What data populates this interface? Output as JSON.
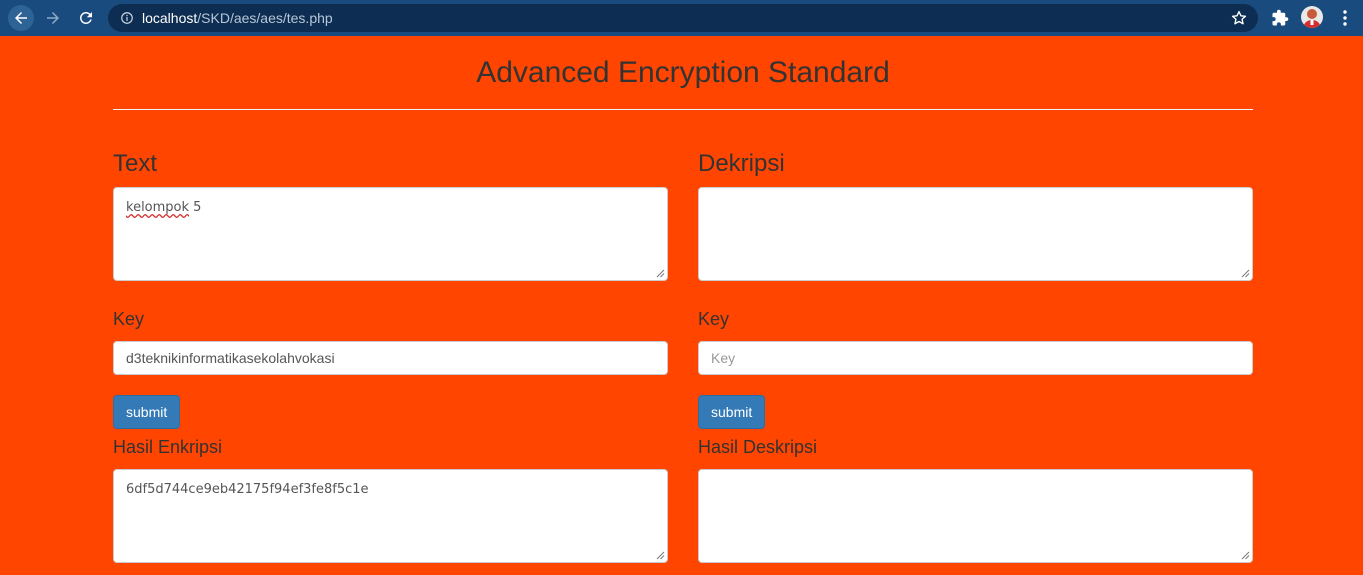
{
  "browser": {
    "url_host": "localhost",
    "url_path": "/SKD/aes/aes/tes.php"
  },
  "page": {
    "title": "Advanced Encryption Standard"
  },
  "encrypt": {
    "heading": "Text",
    "text_word1": "kelompok",
    "text_word2": " 5",
    "key_label": "Key",
    "key_value": "d3teknikinformatikasekolahvokasi",
    "submit_label": "submit",
    "result_label": "Hasil Enkripsi",
    "result_value": "6df5d744ce9eb42175f94ef3fe8f5c1e"
  },
  "decrypt": {
    "heading": "Dekripsi",
    "text_value": "",
    "key_label": "Key",
    "key_placeholder": "Key",
    "submit_label": "submit",
    "result_label": "Hasil Deskripsi",
    "result_value": ""
  },
  "colors": {
    "background": "#ff4500",
    "button": "#337ab7",
    "chrome": "#1a4b7f"
  }
}
